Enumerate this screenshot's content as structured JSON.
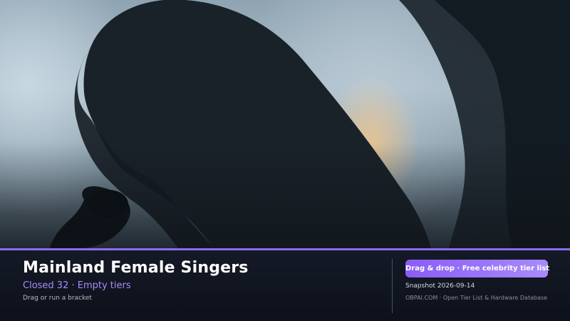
{
  "hero": {
    "image": "silhouette-of-singer-with-microphone-photo"
  },
  "footer": {
    "title": "Mainland Female Singers",
    "subtitle": "Closed 32 · Empty tiers",
    "hint": "Drag or run a bracket",
    "cta_label": "Drag & drop · Free celebrity tier list",
    "snapshot": "Snapshot 2026-09-14",
    "brand": "OBPAI.COM · Open Tier List & Hardware Database"
  },
  "colors": {
    "accent": "#8b5cf6",
    "accent_light": "#a78bfa",
    "footer_bg": "#0d111b"
  }
}
